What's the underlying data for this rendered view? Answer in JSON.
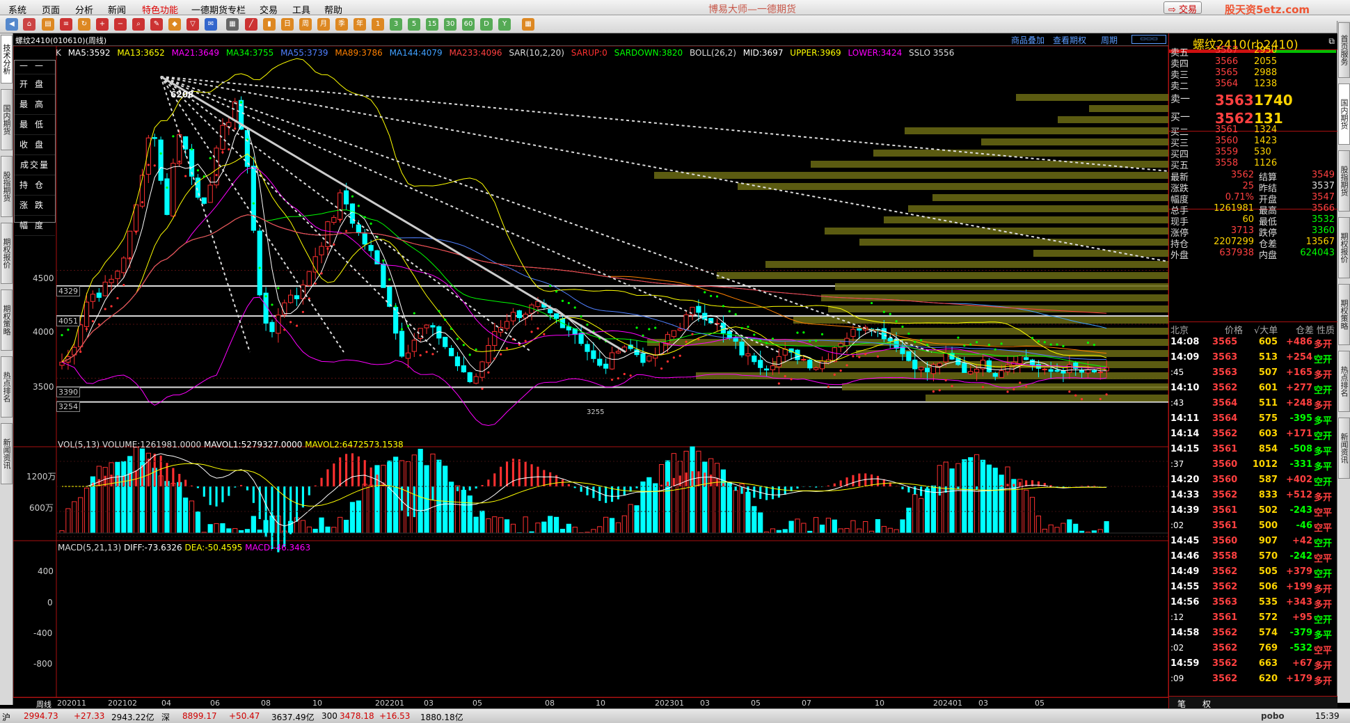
{
  "menu": [
    "系统",
    "页面",
    "分析",
    "新闻",
    "特色功能",
    "一德期货专栏",
    "交易",
    "工具",
    "帮助"
  ],
  "app_title": "博易大师—一德期货",
  "trade_button": "交易",
  "watermark": "股天资5etz.com",
  "left_tabs": [
    "技术分析",
    "国内期货",
    "股指期货",
    "期权报价",
    "期权策略",
    "热点排名",
    "新闻资讯"
  ],
  "right_tabs": [
    "首页服务",
    "国内期货",
    "股指期货",
    "期权报价",
    "期权策略",
    "热点排名",
    "新闻资讯"
  ],
  "contract_line": "螺纹2410(010610)(周线)",
  "top_links": [
    "商品叠加",
    "查看期权",
    "周期"
  ],
  "ma_items": [
    {
      "text": "K",
      "color": "#dddddd"
    },
    {
      "text": "MA5:3592",
      "color": "#ffffff"
    },
    {
      "text": "MA13:3652",
      "color": "#ffff00"
    },
    {
      "text": "MA21:3649",
      "color": "#ff00ff"
    },
    {
      "text": "MA34:3755",
      "color": "#00ff00"
    },
    {
      "text": "MA55:3739",
      "color": "#5080ff"
    },
    {
      "text": "MA89:3786",
      "color": "#ff8000"
    },
    {
      "text": "MA144:4079",
      "color": "#40a0ff"
    },
    {
      "text": "MA233:4096",
      "color": "#ff4040"
    },
    {
      "text": "SAR(10,2,20)",
      "color": "#dddddd"
    },
    {
      "text": "SARUP:0",
      "color": "#ff3030"
    },
    {
      "text": "SARDOWN:3820",
      "color": "#00ff00"
    },
    {
      "text": "BOLL(26,2)",
      "color": "#dddddd"
    },
    {
      "text": "MID:3697",
      "color": "#ffffff"
    },
    {
      "text": "UPPER:3969",
      "color": "#ffff00"
    },
    {
      "text": "LOWER:3424",
      "color": "#ff00ff"
    },
    {
      "text": "SSLO 3556",
      "color": "#dddddd"
    }
  ],
  "ohlc_labels": [
    "开盘",
    "最高",
    "最低",
    "收盘",
    "成交量",
    "持仓",
    "涨跌",
    "幅度"
  ],
  "price_axis": [
    "4500",
    "4000",
    "3500"
  ],
  "price_tags": [
    "4329",
    "4051",
    "3390",
    "3254"
  ],
  "annot_high": "6208",
  "annot_low": "3255",
  "vol_line": [
    {
      "text": "VOL(5,13)",
      "color": "#dddddd"
    },
    {
      "text": "VOLUME:1261981.0000",
      "color": "#dddddd"
    },
    {
      "text": "MAVOL1:5279327.0000",
      "color": "#ffffff"
    },
    {
      "text": "MAVOL2:6472573.1538",
      "color": "#ffff00"
    }
  ],
  "vol_axis": [
    "1200万",
    "600万"
  ],
  "macd_line": [
    {
      "text": "MACD(5,21,13)",
      "color": "#dddddd"
    },
    {
      "text": "DIFF:-73.6326",
      "color": "#ffffff"
    },
    {
      "text": "DEA:-50.4595",
      "color": "#ffff00"
    },
    {
      "text": "MACD:-46.3463",
      "color": "#ff00ff"
    }
  ],
  "macd_axis": [
    "400",
    "0",
    "-400",
    "-800"
  ],
  "x_axis": [
    "周线",
    "202011",
    "202102",
    "04",
    "06",
    "08",
    "10",
    "202201",
    "03",
    "05",
    "08",
    "10",
    "202301",
    "03",
    "05",
    "07",
    "10",
    "202401",
    "03",
    "05"
  ],
  "right_panel": {
    "title": "螺纹2410(rb2410)",
    "asks": [
      {
        "name": "卖五",
        "price": "3567",
        "vol": "2950"
      },
      {
        "name": "卖四",
        "price": "3566",
        "vol": "2055"
      },
      {
        "name": "卖三",
        "price": "3565",
        "vol": "2988"
      },
      {
        "name": "卖二",
        "price": "3564",
        "vol": "1238"
      },
      {
        "name": "卖一",
        "price": "3563",
        "vol": "1740"
      }
    ],
    "bids": [
      {
        "name": "买一",
        "price": "3562",
        "vol": "131"
      },
      {
        "name": "买二",
        "price": "3561",
        "vol": "1324"
      },
      {
        "name": "买三",
        "price": "3560",
        "vol": "1423"
      },
      {
        "name": "买四",
        "price": "3559",
        "vol": "530"
      },
      {
        "name": "买五",
        "price": "3558",
        "vol": "1126"
      }
    ],
    "quote": [
      {
        "l1": "最新",
        "v1": "3562",
        "c1": "#ff4040",
        "l2": "结算",
        "v2": "3549",
        "c2": "#ff4040"
      },
      {
        "l1": "涨跌",
        "v1": "25",
        "c1": "#ff4040",
        "l2": "昨结",
        "v2": "3537",
        "c2": "#dddddd"
      },
      {
        "l1": "幅度",
        "v1": "0.71%",
        "c1": "#ff4040",
        "l2": "开盘",
        "v2": "3547",
        "c2": "#ff4040"
      },
      {
        "l1": "总手",
        "v1": "1261981",
        "c1": "#ffd400",
        "l2": "最高",
        "v2": "3566",
        "c2": "#ff4040"
      },
      {
        "l1": "现手",
        "v1": "60",
        "c1": "#ffd400",
        "l2": "最低",
        "v2": "3532",
        "c2": "#00ff00"
      },
      {
        "l1": "涨停",
        "v1": "3713",
        "c1": "#ff4040",
        "l2": "跌停",
        "v2": "3360",
        "c2": "#00ff00"
      },
      {
        "l1": "持仓",
        "v1": "2207299",
        "c1": "#ffd400",
        "l2": "仓差",
        "v2": "13567",
        "c2": "#ffd400"
      },
      {
        "l1": "外盘",
        "v1": "637938",
        "c1": "#ff4040",
        "l2": "内盘",
        "v2": "624043",
        "c2": "#00ff00"
      }
    ],
    "tick_header": [
      "北京",
      "价格",
      "√大单",
      "仓差",
      "性质"
    ],
    "ticks": [
      {
        "t": "14:08",
        "p": "3565",
        "v": "605",
        "d": "+486",
        "n": "多开",
        "nc": "#ff4040"
      },
      {
        "t": "14:09",
        "p": "3563",
        "v": "513",
        "d": "+254",
        "n": "空开",
        "nc": "#00ff00"
      },
      {
        "t": ":45",
        "p": "3563",
        "v": "507",
        "d": "+165",
        "n": "多开",
        "nc": "#ff4040"
      },
      {
        "t": "14:10",
        "p": "3562",
        "v": "601",
        "d": "+277",
        "n": "空开",
        "nc": "#00ff00"
      },
      {
        "t": ":43",
        "p": "3564",
        "v": "511",
        "d": "+248",
        "n": "多开",
        "nc": "#ff4040"
      },
      {
        "t": "14:11",
        "p": "3564",
        "v": "575",
        "d": "-395",
        "n": "多平",
        "nc": "#00ff00"
      },
      {
        "t": "14:14",
        "p": "3562",
        "v": "603",
        "d": "+171",
        "n": "空开",
        "nc": "#00ff00"
      },
      {
        "t": "14:15",
        "p": "3561",
        "v": "854",
        "d": "-508",
        "n": "多平",
        "nc": "#00ff00"
      },
      {
        "t": ":37",
        "p": "3560",
        "v": "1012",
        "d": "-331",
        "n": "多平",
        "nc": "#00ff00"
      },
      {
        "t": "14:20",
        "p": "3560",
        "v": "587",
        "d": "+402",
        "n": "空开",
        "nc": "#00ff00"
      },
      {
        "t": "14:33",
        "p": "3562",
        "v": "833",
        "d": "+512",
        "n": "多开",
        "nc": "#ff4040"
      },
      {
        "t": "14:39",
        "p": "3561",
        "v": "502",
        "d": "-243",
        "n": "空平",
        "nc": "#ff4040"
      },
      {
        "t": ":02",
        "p": "3561",
        "v": "500",
        "d": "-46",
        "n": "空平",
        "nc": "#ff4040"
      },
      {
        "t": "14:45",
        "p": "3560",
        "v": "907",
        "d": "+42",
        "n": "空开",
        "nc": "#00ff00"
      },
      {
        "t": "14:46",
        "p": "3558",
        "v": "570",
        "d": "-242",
        "n": "空平",
        "nc": "#ff4040"
      },
      {
        "t": "14:49",
        "p": "3562",
        "v": "505",
        "d": "+379",
        "n": "空开",
        "nc": "#00ff00"
      },
      {
        "t": "14:55",
        "p": "3562",
        "v": "506",
        "d": "+199",
        "n": "多开",
        "nc": "#ff4040"
      },
      {
        "t": "14:56",
        "p": "3563",
        "v": "535",
        "d": "+343",
        "n": "多开",
        "nc": "#ff4040"
      },
      {
        "t": ":12",
        "p": "3561",
        "v": "572",
        "d": "+95",
        "n": "空开",
        "nc": "#00ff00"
      },
      {
        "t": "14:58",
        "p": "3562",
        "v": "574",
        "d": "-379",
        "n": "多平",
        "nc": "#00ff00"
      },
      {
        "t": ":02",
        "p": "3562",
        "v": "769",
        "d": "-532",
        "n": "空平",
        "nc": "#ff4040"
      },
      {
        "t": "14:59",
        "p": "3562",
        "v": "663",
        "d": "+67",
        "n": "多开",
        "nc": "#ff4040"
      },
      {
        "t": ":09",
        "p": "3562",
        "v": "620",
        "d": "+179",
        "n": "多开",
        "nc": "#ff4040"
      }
    ],
    "bottom_tabs": [
      "笔",
      "权"
    ]
  },
  "status": [
    {
      "text": "沪",
      "color": "#000000"
    },
    {
      "text": "2994.73",
      "color": "#d00000"
    },
    {
      "text": "+27.33",
      "color": "#d00000"
    },
    {
      "text": "2943.22亿",
      "color": "#000000"
    },
    {
      "text": "深",
      "color": "#000000"
    },
    {
      "text": "8899.17",
      "color": "#d00000"
    },
    {
      "text": "+50.47",
      "color": "#d00000"
    },
    {
      "text": "3637.49亿",
      "color": "#000000"
    },
    {
      "text": "300",
      "color": "#000000"
    },
    {
      "text": "3478.18",
      "color": "#d00000"
    },
    {
      "text": "+16.53",
      "color": "#d00000"
    },
    {
      "text": "1880.18亿",
      "color": "#000000"
    }
  ],
  "status_right": [
    "pobo",
    "15:39"
  ]
}
